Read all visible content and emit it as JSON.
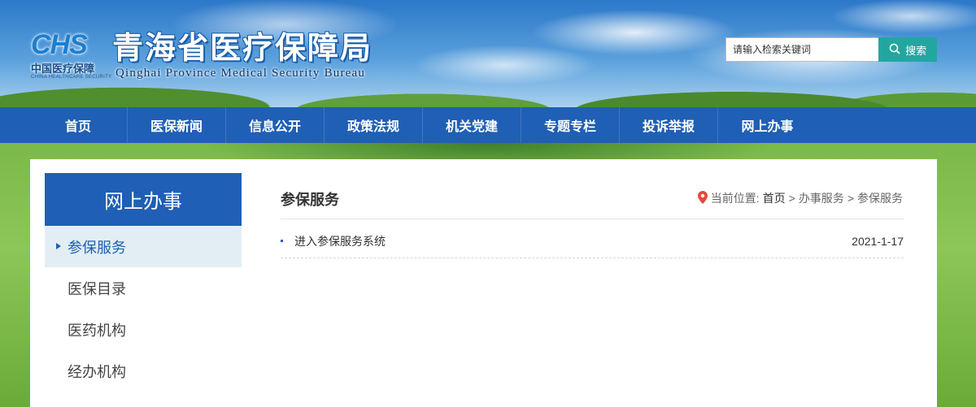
{
  "header": {
    "logo_mark": "CHS",
    "logo_cn": "中国医疗保障",
    "logo_en": "CHINA HEALTHCARE SECURITY",
    "title": "青海省医疗保障局",
    "subtitle": "Qinghai Province Medical Security Bureau",
    "search": {
      "placeholder": "请输入检索关键词",
      "button": "搜索"
    }
  },
  "nav": {
    "items": [
      {
        "label": "首页"
      },
      {
        "label": "医保新闻"
      },
      {
        "label": "信息公开"
      },
      {
        "label": "政策法规"
      },
      {
        "label": "机关党建"
      },
      {
        "label": "专题专栏"
      },
      {
        "label": "投诉举报"
      },
      {
        "label": "网上办事"
      }
    ]
  },
  "sidebar": {
    "title": "网上办事",
    "items": [
      {
        "label": "参保服务",
        "active": true
      },
      {
        "label": "医保目录"
      },
      {
        "label": "医药机构"
      },
      {
        "label": "经办机构"
      }
    ]
  },
  "main": {
    "title": "参保服务",
    "breadcrumb": {
      "prefix": "当前位置:",
      "home": "首页",
      "sep": ">",
      "level1": "办事服务",
      "level2": "参保服务"
    },
    "list": [
      {
        "title": "进入参保服务系统",
        "date": "2021-1-17"
      }
    ]
  },
  "colors": {
    "primary": "#1f5fb5",
    "search_button": "#22a7a0",
    "active_bg": "#e3eef4",
    "pin": "#e24a3b"
  },
  "icons": {
    "search": "search-icon",
    "location": "location-pin-icon"
  }
}
